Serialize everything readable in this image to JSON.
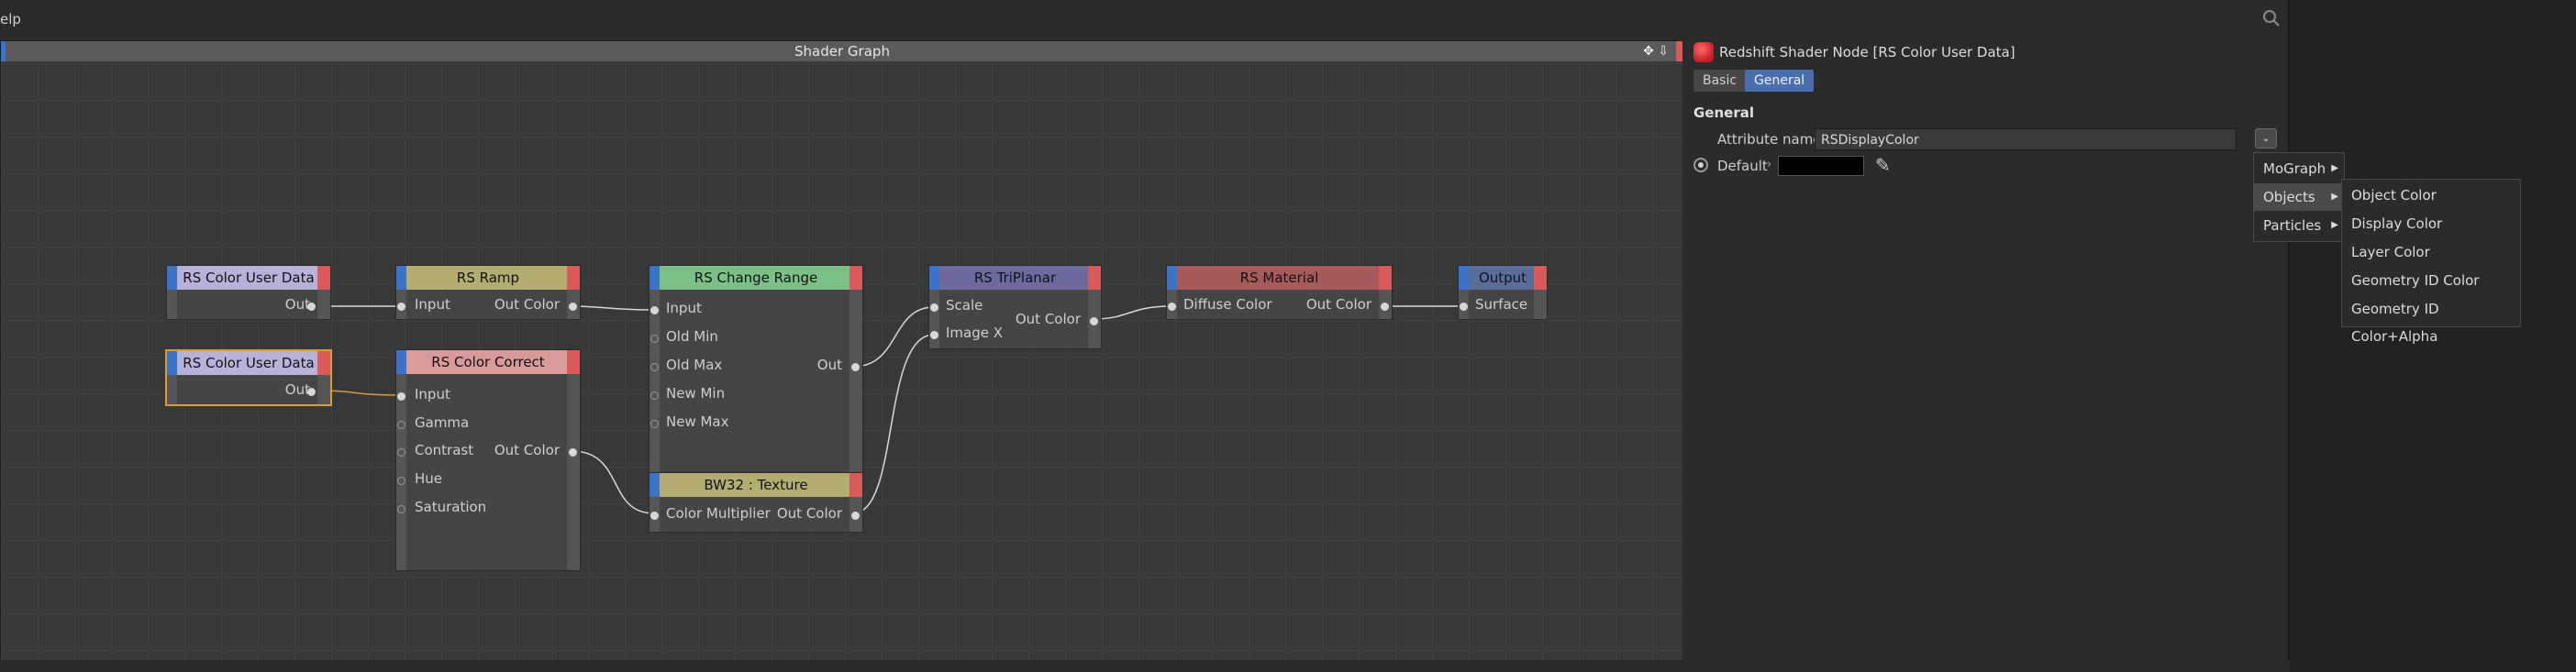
{
  "topbar": {
    "menu_text": "elp"
  },
  "graph": {
    "title": "Shader Graph",
    "tools": "✥ ⇩",
    "nodes": {
      "ud1": {
        "title": "RS Color User Data",
        "out": "Out",
        "color": "#b7b3d8"
      },
      "ud2": {
        "title": "RS Color User Data",
        "out": "Out",
        "color": "#b7b3d8"
      },
      "ramp": {
        "title": "RS Ramp",
        "in": "Input",
        "out": "Out Color",
        "color": "#b3ad72"
      },
      "cc": {
        "title": "RS Color Correct",
        "inputs": [
          "Input",
          "Gamma",
          "Contrast",
          "Hue",
          "Saturation"
        ],
        "out": "Out Color",
        "color": "#d89a9a"
      },
      "chr": {
        "title": "RS Change Range",
        "inputs": [
          "Input",
          "Old Min",
          "Old Max",
          "New Min",
          "New Max"
        ],
        "out": "Out",
        "color": "#7cc085"
      },
      "bw": {
        "title": "BW32 : Texture",
        "in": "Color Multiplier",
        "out": "Out Color",
        "color": "#b3ad72"
      },
      "tri": {
        "title": "RS TriPlanar",
        "inputs": [
          "Scale",
          "Image X"
        ],
        "out": "Out Color",
        "color": "#6e6aa0"
      },
      "mat": {
        "title": "RS Material",
        "in": "Diffuse Color",
        "out": "Out Color",
        "color": "#a85a5a"
      },
      "out": {
        "title": "Output",
        "in": "Surface",
        "color": "#5a6e9a"
      }
    }
  },
  "panel": {
    "title": "Redshift Shader Node [RS Color User Data]",
    "tabs": {
      "basic": "Basic",
      "general": "General"
    },
    "section": "General",
    "attr_name_label": "Attribute name",
    "attr_name_value": "RSDisplayColor",
    "default_label": "Default",
    "default_color": "#000000"
  },
  "menu": {
    "items": [
      "MoGraph",
      "Objects",
      "Particles"
    ],
    "submenu": [
      "Object Color",
      "Display Color",
      "Layer Color",
      "Geometry ID Color",
      "Geometry ID Color+Alpha"
    ]
  }
}
